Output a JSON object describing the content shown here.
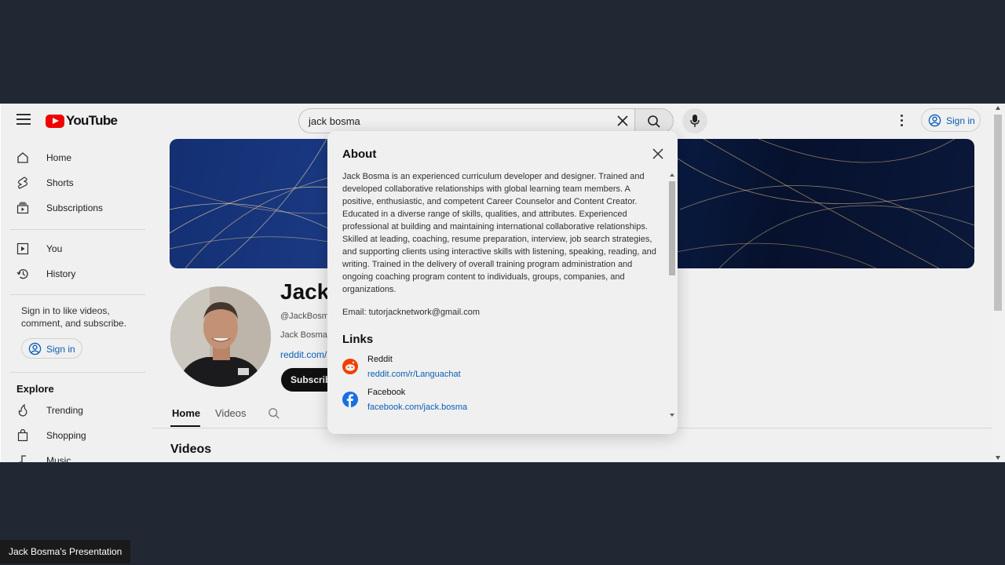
{
  "header": {
    "logo_text": "YouTube",
    "search_value": "jack bosma",
    "sign_in_label": "Sign in"
  },
  "sidebar": {
    "items": [
      {
        "label": "Home",
        "icon": "home-icon"
      },
      {
        "label": "Shorts",
        "icon": "shorts-icon"
      },
      {
        "label": "Subscriptions",
        "icon": "subscriptions-icon"
      },
      {
        "label": "You",
        "icon": "you-icon"
      },
      {
        "label": "History",
        "icon": "history-icon"
      }
    ],
    "signin_prompt": "Sign in to like videos, comment, and subscribe.",
    "signin_label": "Sign in",
    "explore_title": "Explore",
    "explore_items": [
      {
        "label": "Trending",
        "icon": "trending-icon"
      },
      {
        "label": "Shopping",
        "icon": "shopping-icon"
      },
      {
        "label": "Music",
        "icon": "music-icon"
      }
    ]
  },
  "channel": {
    "name": "Jack",
    "handle": "@JackBosm",
    "description": "Jack Bosma",
    "link": "reddit.com/",
    "subscribe_label": "Subscribe",
    "tabs": [
      "Home",
      "Videos"
    ],
    "section_title": "Videos"
  },
  "about_modal": {
    "title": "About",
    "description": "Jack Bosma is an experienced curriculum developer and designer. Trained and developed collaborative relationships with global learning team members. A positive, enthusiastic, and competent Career Counselor and Content Creator. Educated in a diverse range of skills, qualities, and attributes. Experienced professional at building and maintaining international collaborative relationships. Skilled at leading, coaching, resume preparation, interview, job search strategies, and supporting clients using interactive skills with listening, speaking, reading, and writing. Trained in the delivery of overall training program administration and ongoing coaching program content to individuals, groups, companies, and organizations.",
    "email": "Email: tutorjacknetwork@gmail.com",
    "links_title": "Links",
    "links": [
      {
        "name": "Reddit",
        "url": "reddit.com/r/Languachat",
        "icon": "reddit-icon",
        "color": "#ff4500"
      },
      {
        "name": "Facebook",
        "url": "facebook.com/jack.bosma",
        "icon": "facebook-icon",
        "color": "#1877f2"
      }
    ]
  },
  "caption": "Jack Bosma's Presentation",
  "colors": {
    "accent": "#0b65c2",
    "brand": "#ff0000",
    "backdrop": "#222833"
  }
}
